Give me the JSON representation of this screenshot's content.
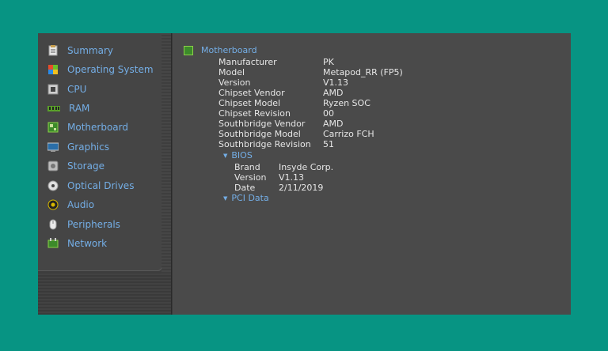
{
  "sidebar": {
    "items": [
      {
        "label": "Summary",
        "icon": "summary-icon"
      },
      {
        "label": "Operating System",
        "icon": "operating-system-icon"
      },
      {
        "label": "CPU",
        "icon": "cpu-icon"
      },
      {
        "label": "RAM",
        "icon": "ram-icon"
      },
      {
        "label": "Motherboard",
        "icon": "motherboard-icon"
      },
      {
        "label": "Graphics",
        "icon": "graphics-icon"
      },
      {
        "label": "Storage",
        "icon": "storage-icon"
      },
      {
        "label": "Optical Drives",
        "icon": "optical-drive-icon"
      },
      {
        "label": "Audio",
        "icon": "audio-icon"
      },
      {
        "label": "Peripherals",
        "icon": "peripherals-icon"
      },
      {
        "label": "Network",
        "icon": "network-icon"
      }
    ]
  },
  "main": {
    "section_title": "Motherboard",
    "properties": [
      {
        "key": "Manufacturer",
        "value": "PK"
      },
      {
        "key": "Model",
        "value": "Metapod_RR (FP5)"
      },
      {
        "key": "Version",
        "value": "V1.13"
      },
      {
        "key": "Chipset Vendor",
        "value": "AMD"
      },
      {
        "key": "Chipset Model",
        "value": "Ryzen SOC"
      },
      {
        "key": "Chipset Revision",
        "value": "00"
      },
      {
        "key": "Southbridge Vendor",
        "value": "AMD"
      },
      {
        "key": "Southbridge Model",
        "value": "Carrizo FCH"
      },
      {
        "key": "Southbridge Revision",
        "value": "51"
      }
    ],
    "bios": {
      "title": "BIOS",
      "properties": [
        {
          "key": "Brand",
          "value": "Insyde Corp."
        },
        {
          "key": "Version",
          "value": "V1.13"
        },
        {
          "key": "Date",
          "value": "2/11/2019"
        }
      ]
    },
    "pci_title": "PCI Data"
  },
  "colors": {
    "background": "#079483",
    "link_text": "#74aee6",
    "value_text": "#e6e6e6"
  }
}
